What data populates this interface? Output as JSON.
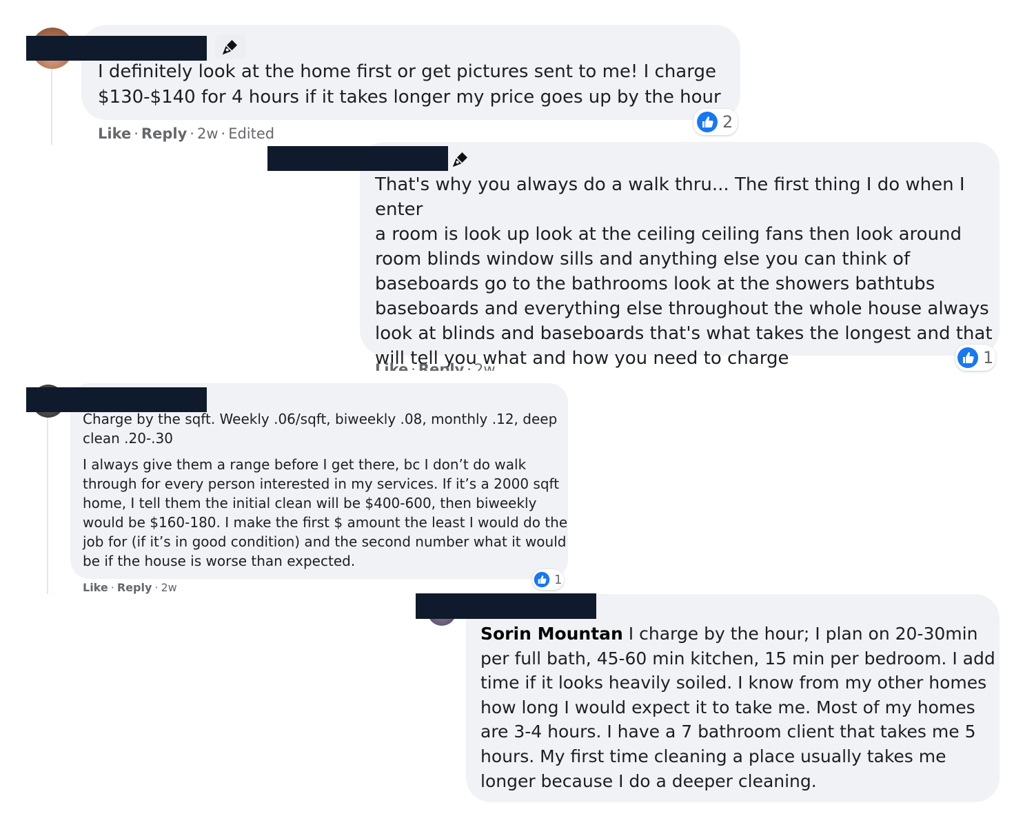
{
  "comments": [
    {
      "text": "I definitely look at the home first or get pictures sent to me! I charge\n$130-$140 for 4 hours if it takes longer my price goes up by the hour",
      "like_label": "Like",
      "reply_label": "Reply",
      "time": "2w",
      "edited_label": "Edited",
      "reaction_count": "2",
      "reaction_icon": "like-icon"
    },
    {
      "text": "That's why you always do a walk thru... The first thing I do when I enter\na room is look up look at the ceiling ceiling fans then look around\nroom blinds window sills and anything else you can think of\nbaseboards go to the bathrooms look at the showers bathtubs\nbaseboards and everything else throughout the whole house always\nlook at blinds and baseboards that's what takes the longest and that\nwill tell you what and how you need to charge",
      "like_label": "Like",
      "reply_label": "Reply",
      "time": "2w",
      "reaction_count": "1",
      "reaction_icon": "like-icon"
    },
    {
      "paragraph_1": "Charge by the sqft. Weekly .06/sqft, biweekly .08, monthly .12, deep\nclean .20-.30",
      "paragraph_2": "I always give them a range before I get there, bc I don’t do walk\nthrough for every person interested in my services. If it’s a 2000 sqft\nhome, I tell them the initial clean will be $400-600, then biweekly\nwould be $160-180. I make the first $ amount the least I would do the\njob for (if it’s in good condition) and the second number what it would\nbe if the house is worse than expected.",
      "like_label": "Like",
      "reply_label": "Reply",
      "time": "2w",
      "reaction_count": "1",
      "reaction_icon": "like-icon"
    },
    {
      "mention": "Sorin Mountan",
      "text": " I charge by the hour; I plan on 20-30min\nper full bath, 45-60 min kitchen, 15 min per bedroom. I add\ntime if it looks heavily soiled. I know from my other homes\nhow long I would expect it to take me. Most of my homes\nare 3-4 hours. I have a 7 bathroom client that takes me 5\nhours. My first time cleaning a place usually takes me\nlonger because I do a deeper cleaning."
    }
  ],
  "separator": "·",
  "colors": {
    "bubble": "#f0f2f5",
    "redaction": "#0f1a2c",
    "like_blue": "#1877f2",
    "meta_gray": "#65676b"
  },
  "icons": [
    "pen-icon",
    "like-icon",
    "avatar"
  ]
}
